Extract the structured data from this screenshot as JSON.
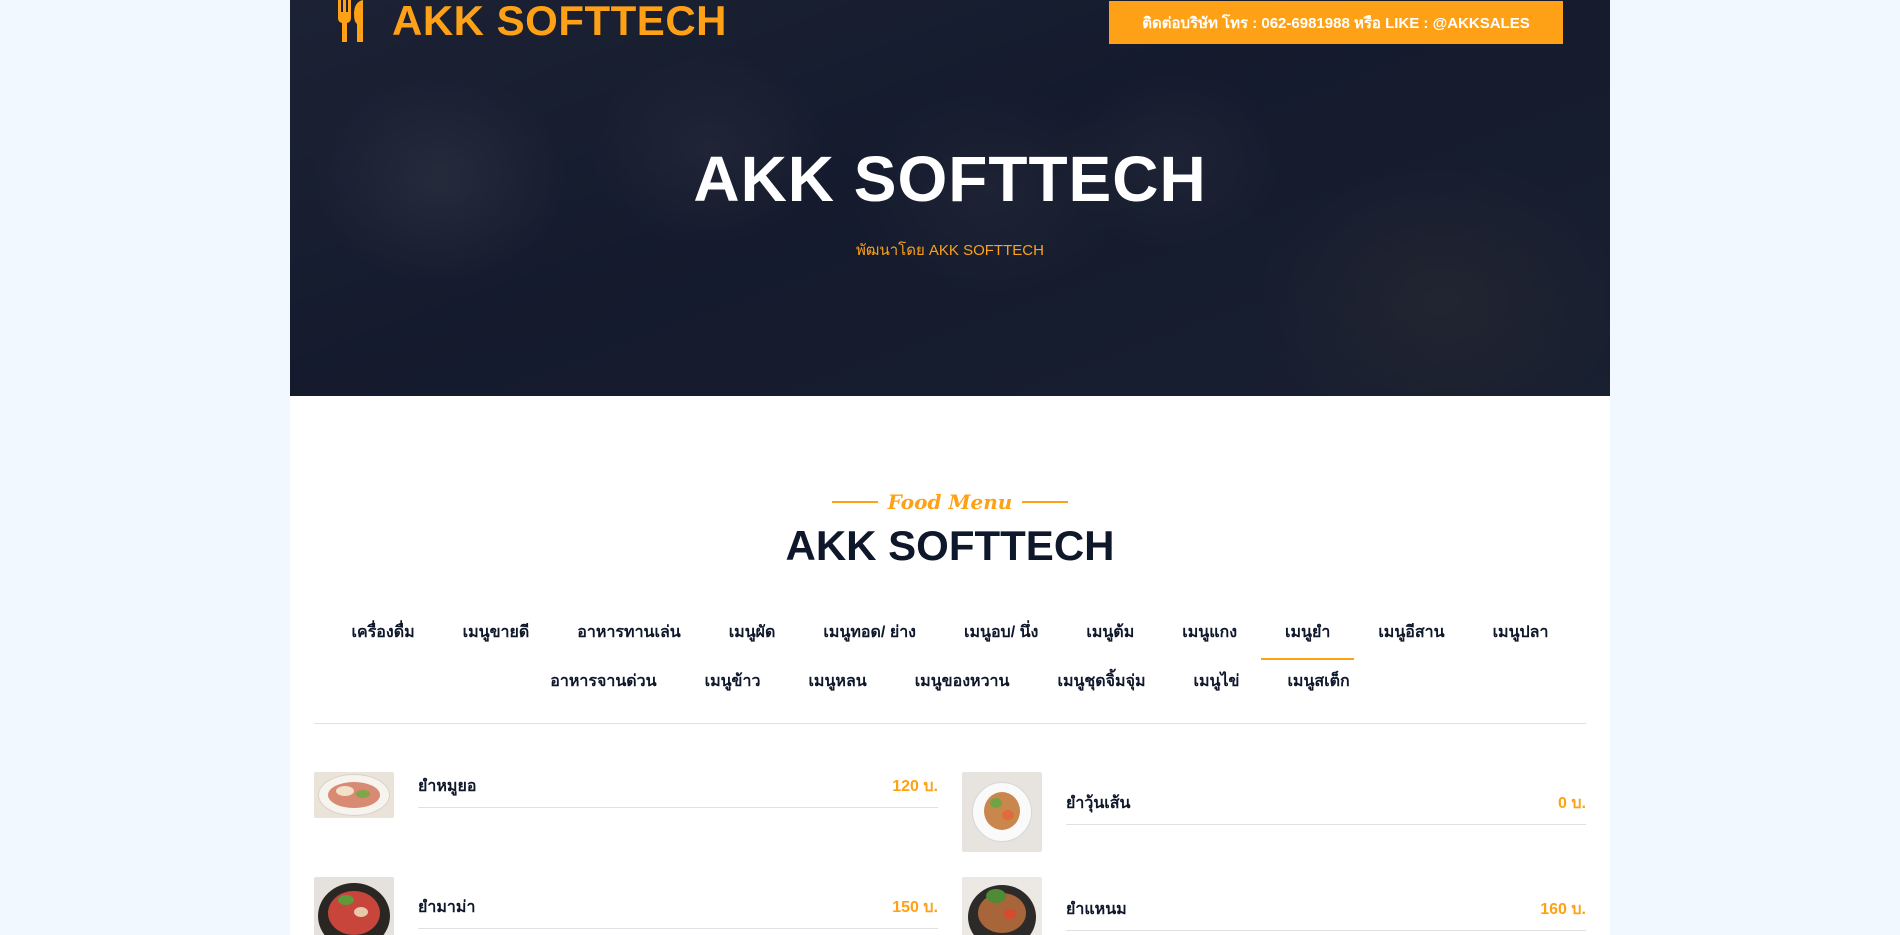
{
  "brand": {
    "name": "AKK SOFTTECH",
    "icon": "utensils-icon"
  },
  "contact": {
    "label": "ติดต่อบริษัท โทร : 062-6981988 หรือ LIKE : @AKKSALES"
  },
  "hero": {
    "title": "AKK SOFTTECH",
    "subtitle": "พัฒนาโดย AKK SOFTTECH"
  },
  "section": {
    "tag": "Food Menu",
    "title": "AKK SOFTTECH"
  },
  "tabs": {
    "row1": [
      "เครื่องดื่ม",
      "เมนูขายดี",
      "อาหารทานเล่น",
      "เมนูผัด",
      "เมนูทอด/ ย่าง",
      "เมนูอบ/ นึ่ง",
      "เมนูต้ม",
      "เมนูแกง",
      "เมนูยำ",
      "เมนูอีสาน",
      "เมนูปลา"
    ],
    "row2": [
      "อาหารจานด่วน",
      "เมนูข้าว",
      "เมนูหลน",
      "เมนูของหวาน",
      "เมนูชุดจิ้มจุ่ม",
      "เมนูไข่",
      "เมนูสเต็ก"
    ],
    "active": "เมนูยำ"
  },
  "items": [
    {
      "name": "ยำหมูยอ",
      "price": "120 บ."
    },
    {
      "name": "ยำวุ้นเส้น",
      "price": "0 บ."
    },
    {
      "name": "ยำมาม่า",
      "price": "150 บ."
    },
    {
      "name": "ยำแหนม",
      "price": "160 บ."
    }
  ],
  "colors": {
    "accent": "#FEA116",
    "dark": "#0F172B",
    "page_bg": "#f1f8ff"
  }
}
